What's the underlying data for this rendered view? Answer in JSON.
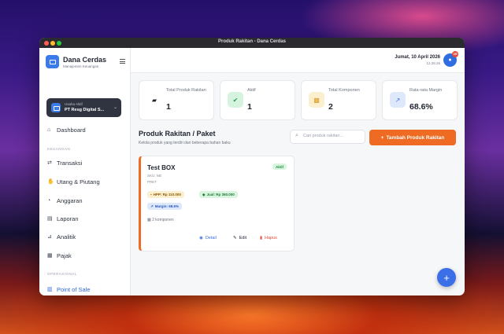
{
  "window": {
    "title": "Produk Rakitan - Dana Cerdas"
  },
  "brand": {
    "name": "Dana Cerdas",
    "subtitle": "Manajemen Keuangan"
  },
  "business": {
    "label": "Usaha Aktif",
    "value": "PT Resg Digital S..."
  },
  "sidebar": {
    "dashboard": "Dashboard",
    "section_keuangan": "KEUANGAN",
    "transaksi": "Transaksi",
    "utang": "Utang & Piutang",
    "anggaran": "Anggaran",
    "laporan": "Laporan",
    "analitik": "Analitik",
    "pajak": "Pajak",
    "section_operasional": "OPERASIONAL",
    "pos": "Point of Sale"
  },
  "header": {
    "date": "Jumat, 10 April 2026",
    "time": "12.28.26",
    "notif_count": "10"
  },
  "stats": [
    {
      "label": "Total Produk Rakitan",
      "value": "1",
      "icon": "boxes-icon",
      "color": "#1f2430"
    },
    {
      "label": "Aktif",
      "value": "1",
      "icon": "check-icon",
      "color": "#1e9e50"
    },
    {
      "label": "Total Komponen",
      "value": "2",
      "icon": "cubes-icon",
      "color": "#d99a1a"
    },
    {
      "label": "Rata-rata Margin",
      "value": "68.6%",
      "icon": "chart-icon",
      "color": "#3b6fe8"
    }
  ],
  "page": {
    "title": "Produk Rakitan / Paket",
    "subtitle": "Kelola produk yang terdiri dari beberapa bahan baku"
  },
  "search": {
    "placeholder": "Cari produk rakitan..."
  },
  "add_button": "Tambah Produk Rakitan",
  "product": {
    "name": "Test BOX",
    "sku": "SKU: NB",
    "category": "PRET",
    "status": "Aktif",
    "hpp": "HPP: Rp 110.000",
    "jual": "Jual: Rp 350.000",
    "margin": "Margin: 68.6%",
    "components": "2 komponen",
    "detail": "Detail",
    "edit": "Edit",
    "delete": "Hapus"
  },
  "colors": {
    "accent": "#ef6a22",
    "primary": "#3b6fe8"
  }
}
